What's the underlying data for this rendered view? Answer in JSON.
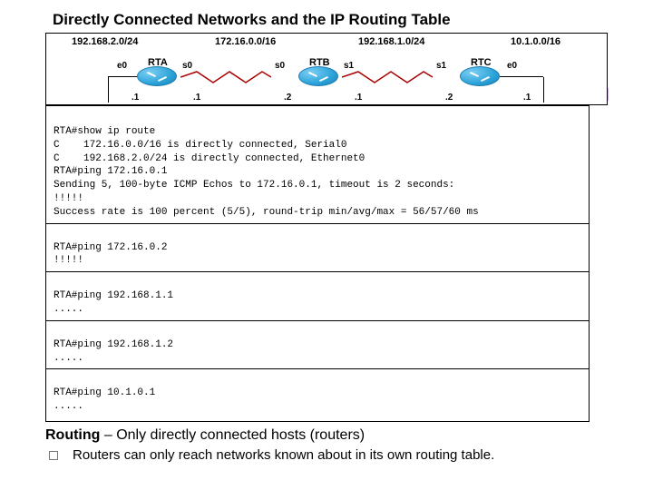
{
  "title": "Directly Connected Networks and the IP Routing Table",
  "diagram": {
    "networks": [
      "192.168.2.0/24",
      "172.16.0.0/16",
      "192.168.1.0/24",
      "10.1.0.0/16"
    ],
    "routers": [
      {
        "name": "RTA",
        "left_if": "e0",
        "right_if": "s0"
      },
      {
        "name": "RTB",
        "left_if": "s0",
        "right_if": "s1"
      },
      {
        "name": "RTC",
        "left_if": "s1",
        "right_if": "e0"
      }
    ],
    "bottom_ips": [
      ".1",
      ".1",
      ".2",
      ".1",
      ".2",
      ".1"
    ]
  },
  "terminal": {
    "block1_l1": "RTA#show ip route",
    "block1_l2": "C    172.16.0.0/16 is directly connected, Serial0",
    "block1_l3": "C    192.168.2.0/24 is directly connected, Ethernet0",
    "block1_l4": "RTA#ping 172.16.0.1",
    "block1_l5": "Sending 5, 100-byte ICMP Echos to 172.16.0.1, timeout is 2 seconds:",
    "block1_l6": "!!!!!",
    "block1_l7": "Success rate is 100 percent (5/5), round-trip min/avg/max = 56/57/60 ms",
    "block2_l1": "RTA#ping 172.16.0.2",
    "block2_l2": "!!!!!",
    "block3_l1": "RTA#ping 192.168.1.1",
    "block3_l2": ".....",
    "block4_l1": "RTA#ping 192.168.1.2",
    "block4_l2": ".....",
    "block5_l1": "RTA#ping 10.1.0.1",
    "block5_l2": "....."
  },
  "subtitle_bold": "Routing",
  "subtitle_rest": " – Only directly connected hosts (routers)",
  "bullet": "Routers can only reach networks known about in its own routing table."
}
